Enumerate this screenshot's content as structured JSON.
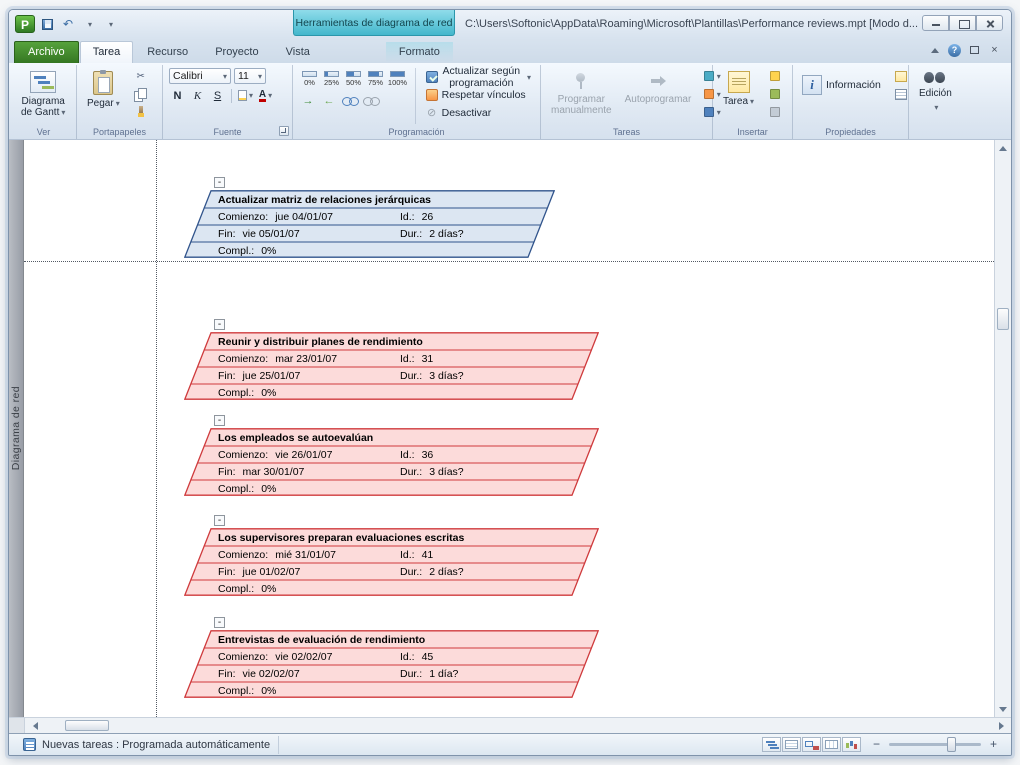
{
  "titlebar": {
    "context_title": "Herramientas de diagrama de red",
    "document_path": "C:\\Users\\Softonic\\AppData\\Roaming\\Microsoft\\Plantillas\\Performance reviews.mpt [Modo d..."
  },
  "icons": {
    "app": "P",
    "help": "?",
    "scissors": "✂",
    "undo": "↶",
    "close": "×",
    "inactivate_glyph": "⊘",
    "link_arrow_right": "→",
    "link_arrow_left": "←",
    "zoom_out": "−",
    "zoom_in": "+",
    "collapse": "-"
  },
  "ribbon": {
    "tabs": [
      {
        "label": "Archivo"
      },
      {
        "label": "Tarea"
      },
      {
        "label": "Recurso"
      },
      {
        "label": "Proyecto"
      },
      {
        "label": "Vista"
      },
      {
        "label": "Formato"
      }
    ],
    "groups": {
      "ver": {
        "label": "Ver",
        "button_line1": "Diagrama",
        "button_line2": "de Gantt"
      },
      "portapapeles": {
        "label": "Portapapeles",
        "paste": "Pegar"
      },
      "fuente": {
        "label": "Fuente",
        "font_name": "Calibri",
        "font_size": "11",
        "bold": "N",
        "italic": "K",
        "underline": "S"
      },
      "programacion": {
        "label": "Programación",
        "percents": [
          "0%",
          "25%",
          "50%",
          "75%",
          "100%"
        ],
        "update": "Actualizar según programación",
        "respect_links": "Respetar vínculos",
        "inactivate": "Desactivar"
      },
      "tareas": {
        "label": "Tareas",
        "manual_line1": "Programar",
        "manual_line2": "manualmente",
        "auto": "Autoprogramar"
      },
      "insertar": {
        "label": "Insertar",
        "task": "Tarea"
      },
      "propiedades": {
        "label": "Propiedades",
        "info": "Información"
      },
      "edicion": {
        "label": "Edición"
      }
    }
  },
  "view_label": "Diagrama de red",
  "node_labels": {
    "start": "Comienzo:",
    "id": "Id.:",
    "finish": "Fin:",
    "duration": "Dur.:",
    "complete": "Compl.:"
  },
  "node_colors": {
    "normal": {
      "fill": "#dce6f2",
      "border": "#31548c"
    },
    "critical": {
      "fill": "#fcdbda",
      "border": "#cf3a3c"
    }
  },
  "nodes": [
    {
      "title": "Actualizar matriz de relaciones jerárquicas",
      "start": "jue 04/01/07",
      "id": "26",
      "finish": "vie 05/01/07",
      "duration": "2 días?",
      "complete": "0%",
      "critical": false
    },
    {
      "title": "Reunir y distribuir planes de rendimiento",
      "start": "mar 23/01/07",
      "id": "31",
      "finish": "jue 25/01/07",
      "duration": "3 días?",
      "complete": "0%",
      "critical": true
    },
    {
      "title": "Los empleados se autoevalúan",
      "start": "vie 26/01/07",
      "id": "36",
      "finish": "mar 30/01/07",
      "duration": "3 días?",
      "complete": "0%",
      "critical": true
    },
    {
      "title": "Los supervisores preparan evaluaciones escritas",
      "start": "mié 31/01/07",
      "id": "41",
      "finish": "jue 01/02/07",
      "duration": "2 días?",
      "complete": "0%",
      "critical": true
    },
    {
      "title": "Entrevistas de evaluación de rendimiento",
      "start": "vie 02/02/07",
      "id": "45",
      "finish": "vie 02/02/07",
      "duration": "1 día?",
      "complete": "0%",
      "critical": true
    }
  ],
  "statusbar": {
    "text": "Nuevas tareas : Programada automáticamente"
  }
}
